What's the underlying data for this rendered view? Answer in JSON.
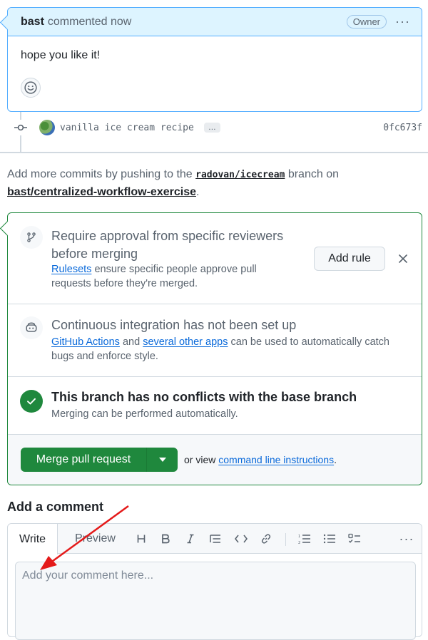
{
  "comment": {
    "author": "bast",
    "action": "commented now",
    "badge": "Owner",
    "more": "···",
    "body": "hope you like it!"
  },
  "commit": {
    "message": "vanilla ice cream recipe",
    "more": "…",
    "sha": "0fc673f"
  },
  "push_note": {
    "prefix": "Add more commits by pushing to the",
    "branch": "radovan/icecream",
    "middle": "branch on",
    "repo": "bast/centralized-workflow-exercise",
    "suffix": "."
  },
  "merge": {
    "reviewers": {
      "title": "Require approval from specific reviewers before merging",
      "link": "Rulesets",
      "desc": "ensure specific people approve pull requests before they're merged.",
      "button": "Add rule",
      "close": "×"
    },
    "ci": {
      "title": "Continuous integration has not been set up",
      "link1": "GitHub Actions",
      "and": "and",
      "link2": "several other apps",
      "desc": "can be used to automatically catch bugs and enforce style."
    },
    "conflicts": {
      "title": "This branch has no conflicts with the base branch",
      "desc": "Merging can be performed automatically."
    },
    "button": "Merge pull request",
    "or_view": "or view",
    "cli_link": "command line instructions",
    "period": "."
  },
  "add_comment": {
    "heading": "Add a comment",
    "tab_write": "Write",
    "tab_preview": "Preview",
    "placeholder": "Add your comment here...",
    "toolbar_more": "···"
  },
  "colors": {
    "accent": "#0969da",
    "success": "#1f883d",
    "annotation_arrow": "#e41a1a"
  }
}
